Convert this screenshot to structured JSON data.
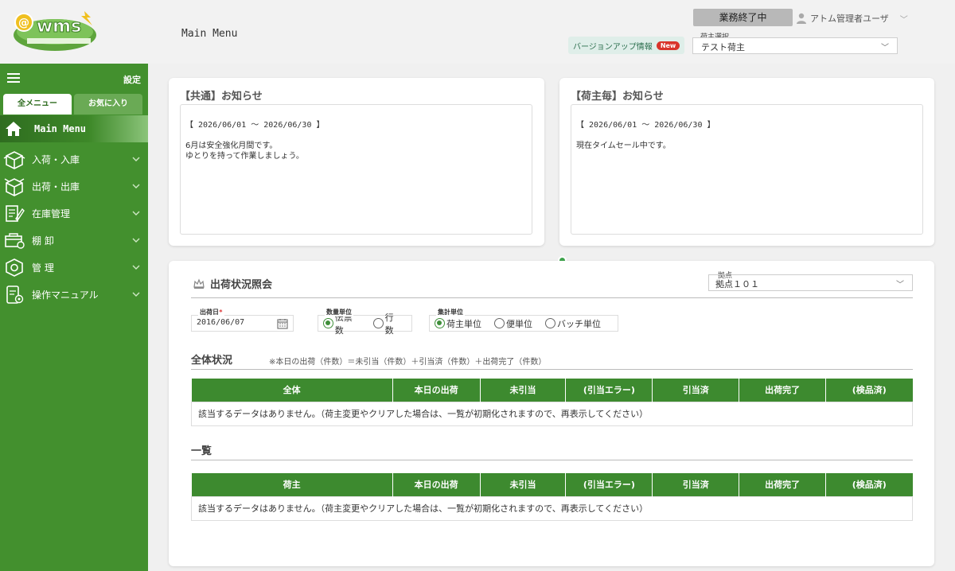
{
  "header": {
    "page_title": "Main Menu",
    "end_work_label": "業務終了中",
    "user_name": "アトム管理者ユーザ",
    "version_label": "バージョンアップ情報",
    "new_badge": "New",
    "shipper_label": "荷主選択",
    "shipper_value": "テスト荷主"
  },
  "sidebar": {
    "settings": "設定",
    "tabs": [
      {
        "label": "全メニュー"
      },
      {
        "label": "お気に入り"
      }
    ],
    "main_menu": "Main Menu",
    "items": [
      {
        "label": "入荷・入庫",
        "icon": "box-in-icon"
      },
      {
        "label": "出荷・出庫",
        "icon": "box-out-icon"
      },
      {
        "label": "在庫管理",
        "icon": "inventory-icon"
      },
      {
        "label": "棚 卸",
        "icon": "stocktake-icon"
      },
      {
        "label": "管 理",
        "icon": "admin-icon"
      },
      {
        "label": "操作マニュアル",
        "icon": "manual-icon"
      }
    ]
  },
  "notices": {
    "common": {
      "title": "【共通】お知らせ",
      "period": "【 2026/06/01 ～ 2026/06/30 】",
      "body": "6月は安全強化月間です。\nゆとりを持って作業しましょう。"
    },
    "shipper": {
      "title": "【荷主毎】お知らせ",
      "period": "【 2026/06/01 ～ 2026/06/30 】",
      "body": "現在タイムセール中です。"
    }
  },
  "shipping": {
    "title": "出荷状況照会",
    "base_label": "拠点",
    "base_value": "拠点１０１",
    "date_label": "出荷日",
    "date_required": "*",
    "date_value": "2016/06/07",
    "qty_label": "数量単位",
    "qty_options": [
      "伝票数",
      "行数"
    ],
    "agg_label": "集計単位",
    "agg_options": [
      "荷主単位",
      "便単位",
      "バッチ単位"
    ],
    "overall_title": "全体状況",
    "formula": "※本日の出荷（件数）＝未引当（件数）＋引当済（件数）＋出荷完了（件数）",
    "overall_headers": [
      "全体",
      "本日の出荷",
      "未引当",
      "(引当エラー)",
      "引当済",
      "出荷完了",
      "(検品済)"
    ],
    "empty_message": "該当するデータはありません。（荷主変更やクリアした場合は、一覧が初期化されますので、再表示してください）",
    "list_title": "一覧",
    "list_headers": [
      "荷主",
      "本日の出荷",
      "未引当",
      "(引当エラー)",
      "引当済",
      "出荷完了",
      "(検品済)"
    ]
  },
  "colors": {
    "sidebar": "#43902e",
    "table_header": "#3d8a2f",
    "new_badge": "#d9342b"
  }
}
